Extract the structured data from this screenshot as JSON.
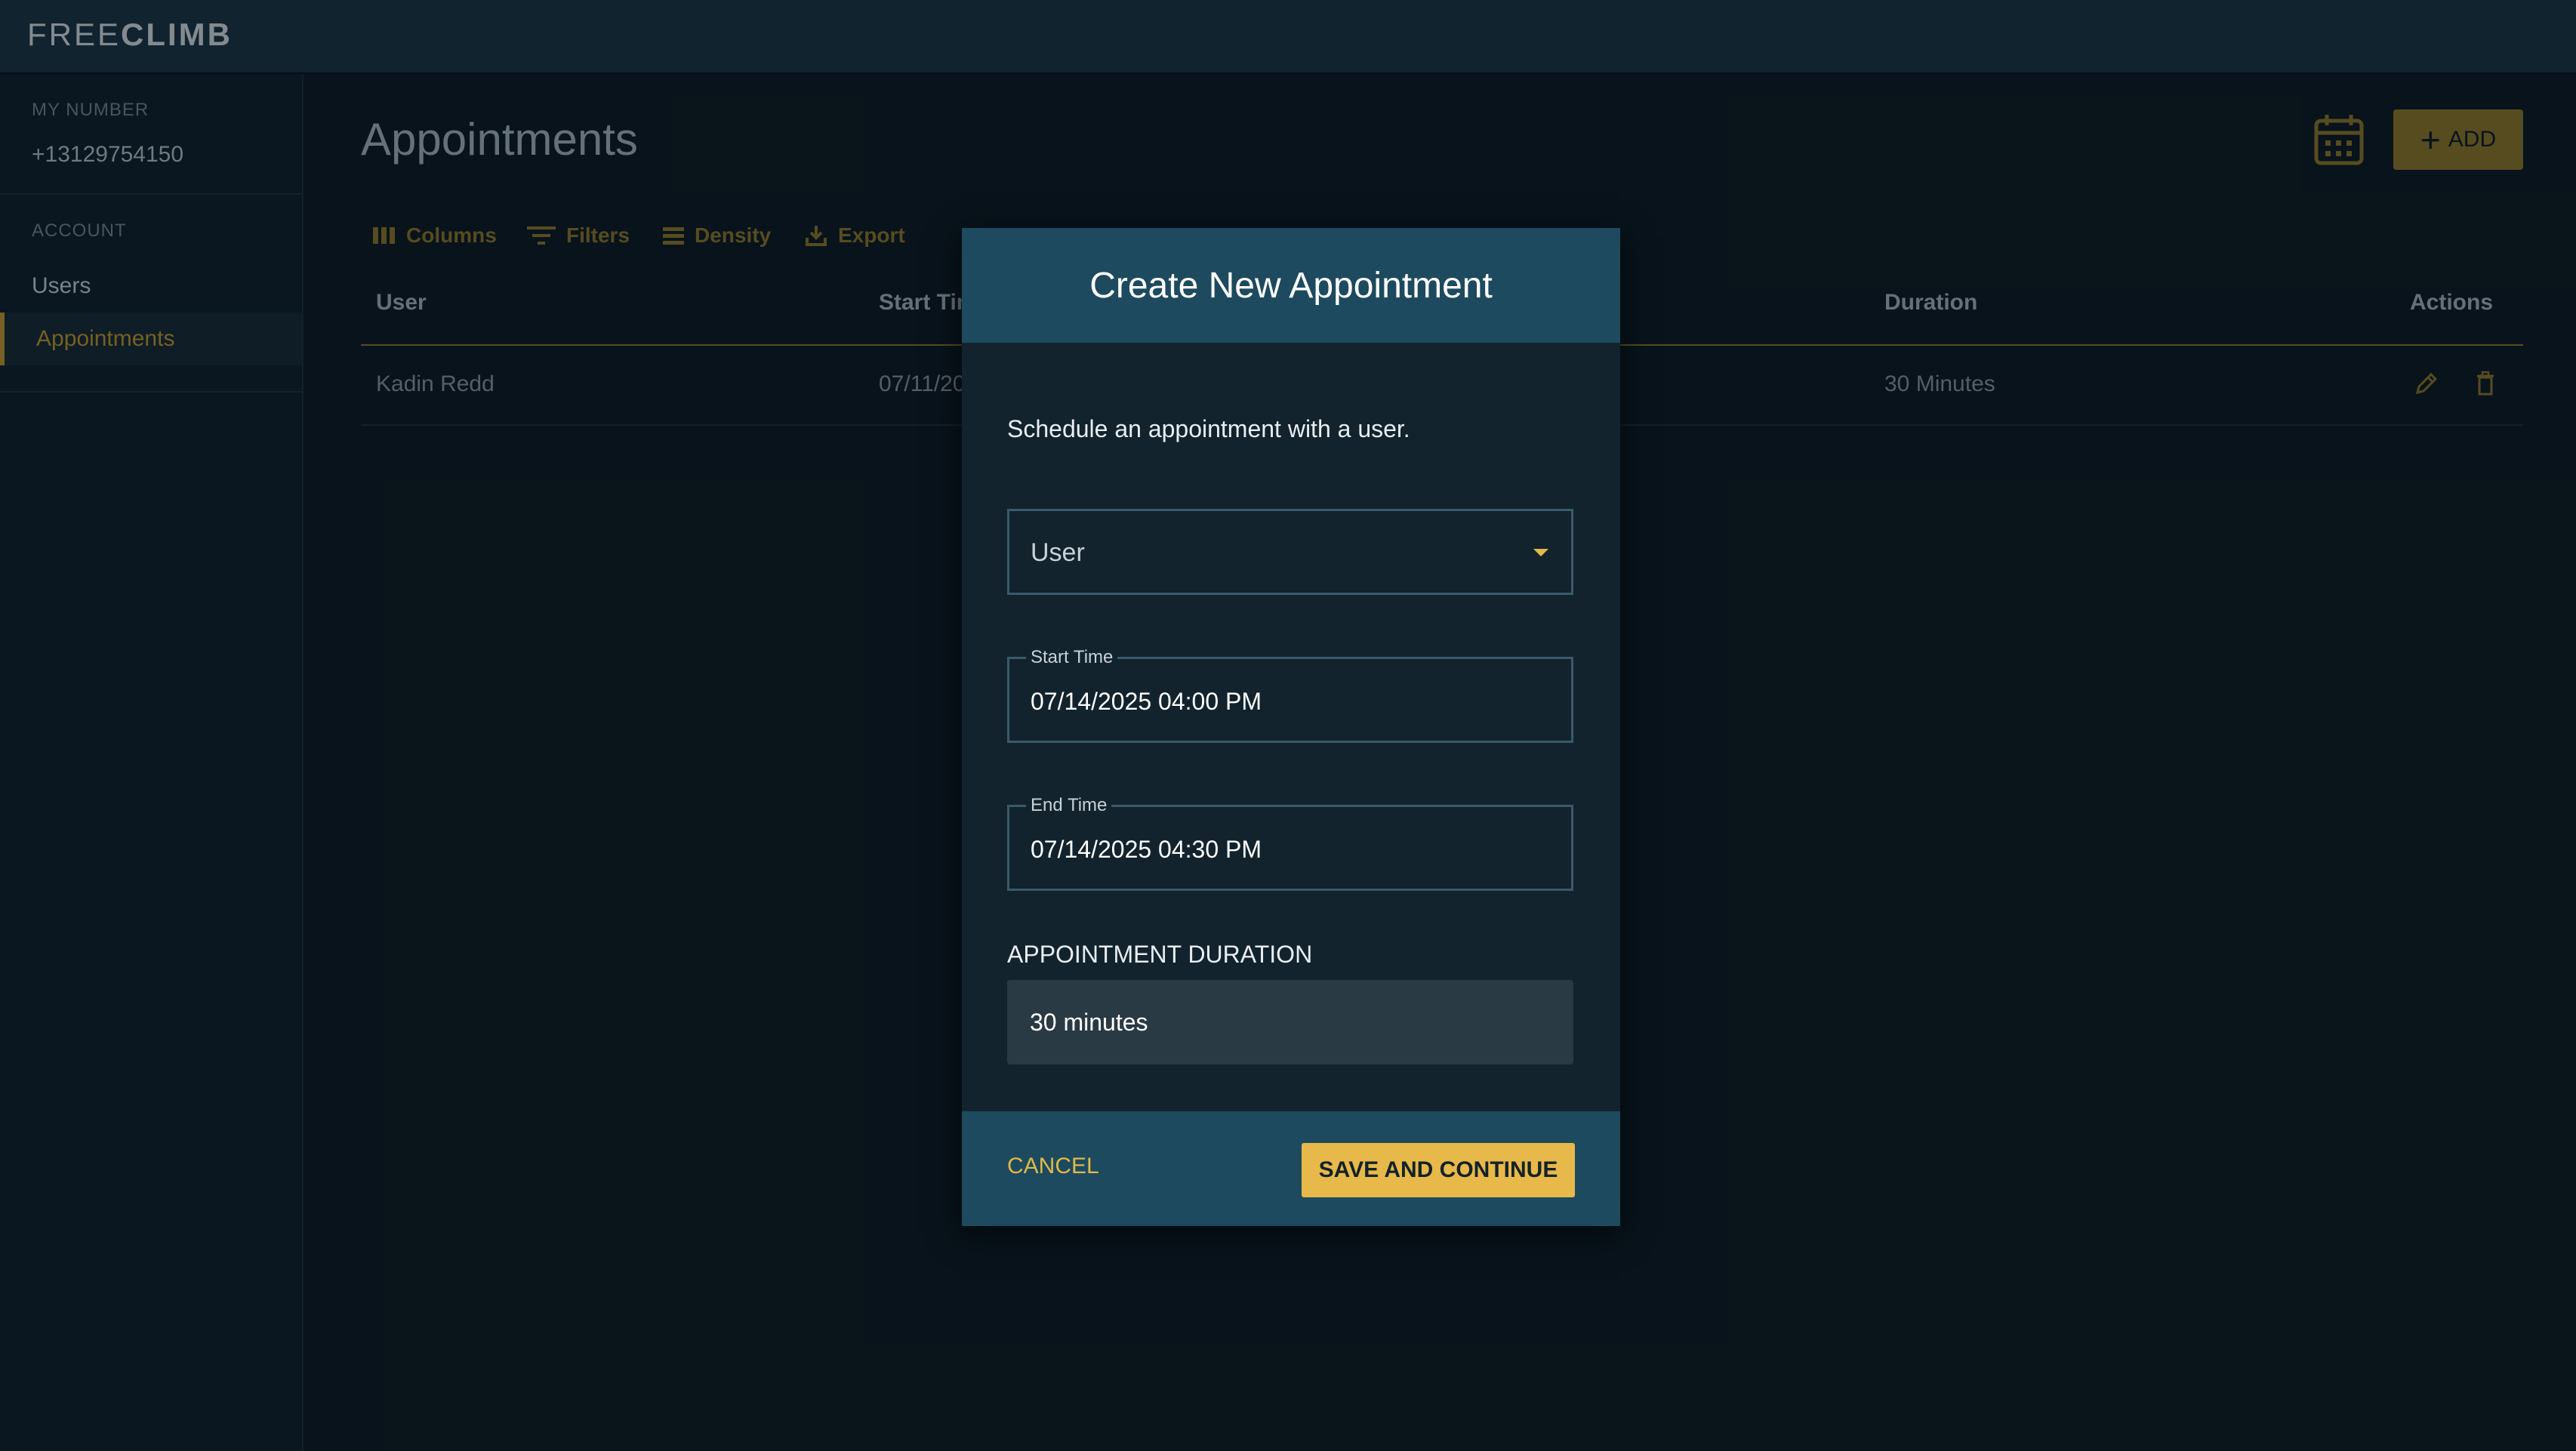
{
  "app": {
    "logo_light": "FREE",
    "logo_bold": "CLIMB"
  },
  "sidebar": {
    "my_number_label": "MY NUMBER",
    "my_number_value": "+13129754150",
    "account_label": "ACCOUNT",
    "items": [
      {
        "label": "Users",
        "active": false
      },
      {
        "label": "Appointments",
        "active": true
      }
    ]
  },
  "main": {
    "title": "Appointments",
    "add_button_label": "ADD",
    "calendar_icon": "calendar-icon",
    "toolbar": {
      "columns": "Columns",
      "filters": "Filters",
      "density": "Density",
      "export": "Export"
    },
    "table": {
      "headers": [
        "User",
        "Start Time",
        "Duration",
        "Actions"
      ],
      "rows": [
        {
          "user": "Kadin Redd",
          "start_time": "07/11/20",
          "duration": "30 Minutes"
        }
      ]
    }
  },
  "modal": {
    "title": "Create New Appointment",
    "description": "Schedule an appointment with a user.",
    "user_select_placeholder": "User",
    "start_time_label": "Start Time",
    "start_time_value": "07/14/2025 04:00 PM",
    "end_time_label": "End Time",
    "end_time_value": "07/14/2025 04:30 PM",
    "duration_label": "APPOINTMENT DURATION",
    "duration_value": "30 minutes",
    "cancel_label": "CANCEL",
    "save_label": "SAVE AND CONTINUE"
  },
  "colors": {
    "accent_gold": "#e7b94a",
    "header_teal": "#1d4a5e",
    "background": "#0c1922"
  }
}
